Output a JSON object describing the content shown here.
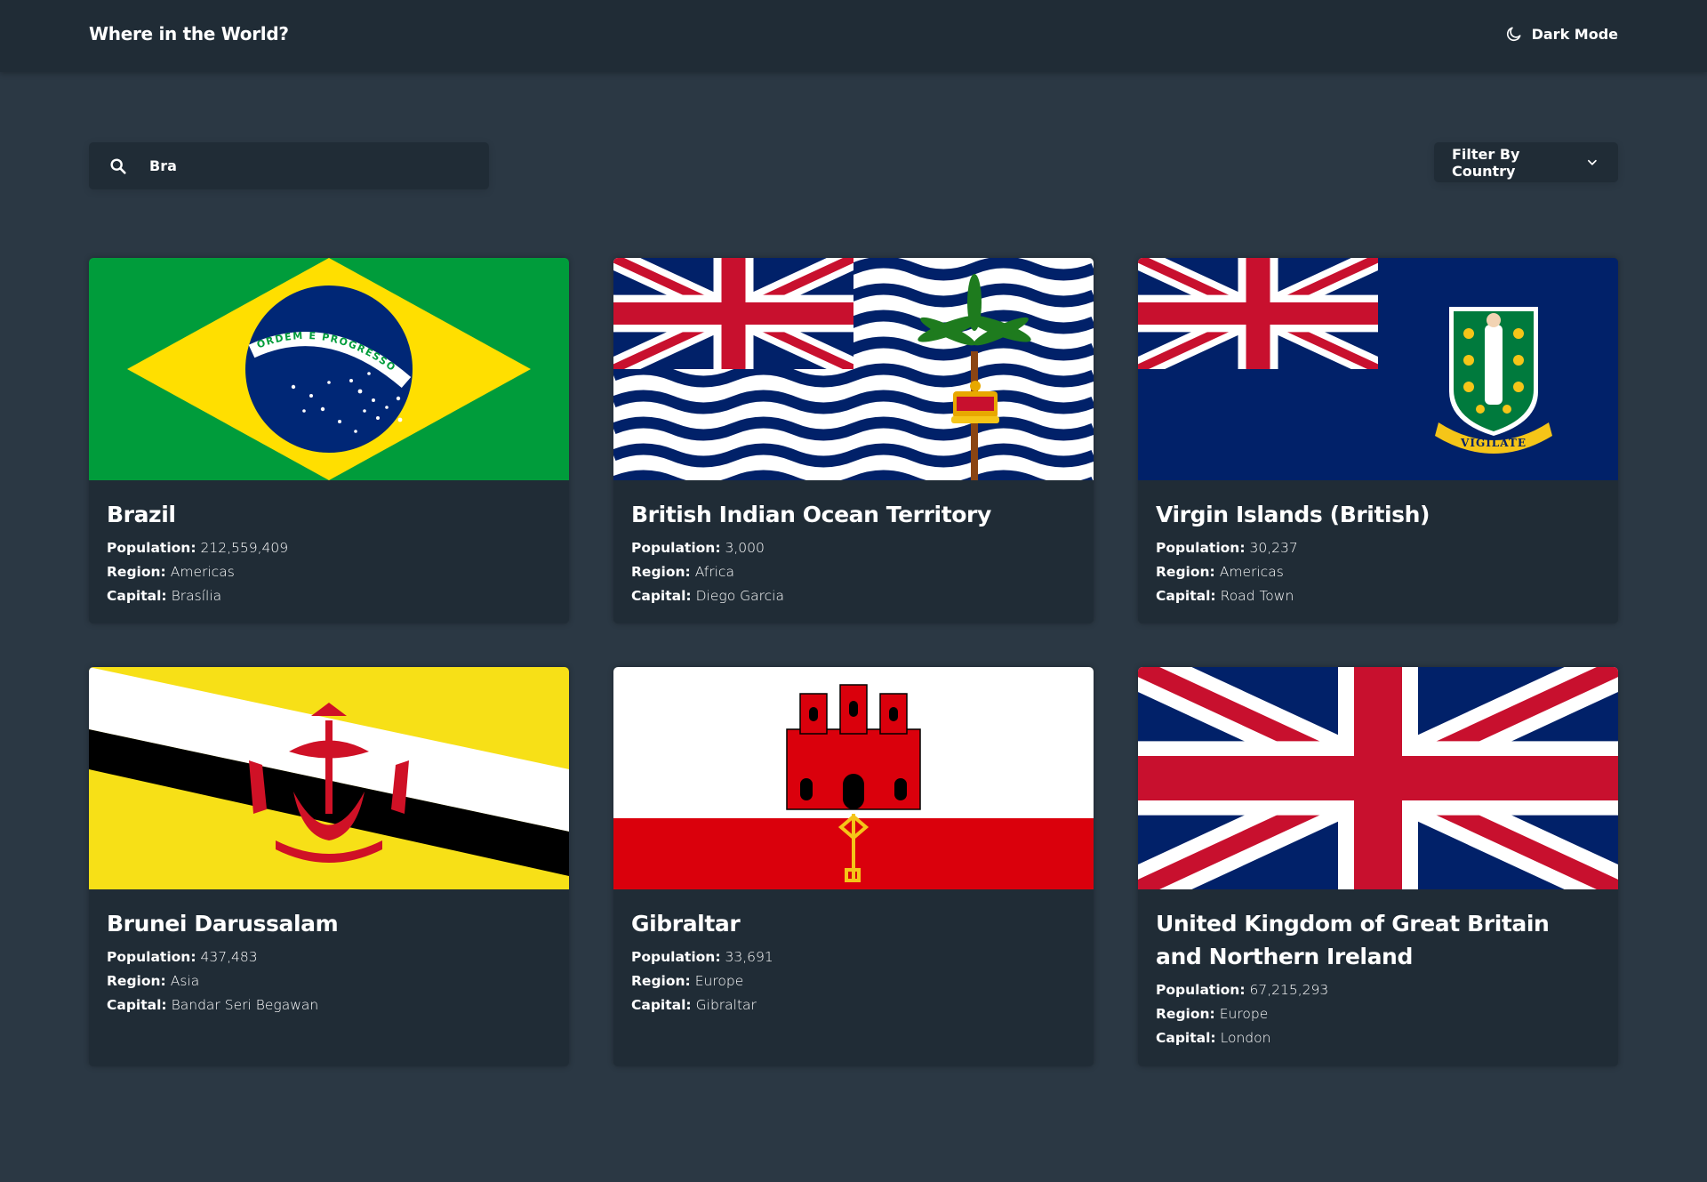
{
  "header": {
    "title": "Where in the World?",
    "theme_toggle_label": "Dark Mode",
    "theme_icon": "moon-icon"
  },
  "search": {
    "value": "Bra",
    "icon": "search-icon"
  },
  "filter": {
    "label": "Filter By Country",
    "icon": "chevron-down-icon"
  },
  "labels": {
    "population": "Population:",
    "region": "Region:",
    "capital": "Capital:"
  },
  "colors": {
    "background": "#2b3844",
    "surface": "#202c36",
    "text": "#ffffff"
  },
  "countries": [
    {
      "name": "Brazil",
      "population": "212,559,409",
      "region": "Americas",
      "capital": "Brasília",
      "flag": "flag-brazil",
      "flag_motto": "ORDEM E PROGRESSO"
    },
    {
      "name": "British Indian Ocean Territory",
      "population": "3,000",
      "region": "Africa",
      "capital": "Diego Garcia",
      "flag": "flag-british-indian-ocean-territory"
    },
    {
      "name": "Virgin Islands (British)",
      "population": "30,237",
      "region": "Americas",
      "capital": "Road Town",
      "flag": "flag-british-virgin-islands",
      "flag_motto": "VIGILATE"
    },
    {
      "name": "Brunei Darussalam",
      "population": "437,483",
      "region": "Asia",
      "capital": "Bandar Seri Begawan",
      "flag": "flag-brunei"
    },
    {
      "name": "Gibraltar",
      "population": "33,691",
      "region": "Europe",
      "capital": "Gibraltar",
      "flag": "flag-gibraltar"
    },
    {
      "name": "United Kingdom of Great Britain and Northern Ireland",
      "population": "67,215,293",
      "region": "Europe",
      "capital": "London",
      "flag": "flag-united-kingdom"
    }
  ]
}
